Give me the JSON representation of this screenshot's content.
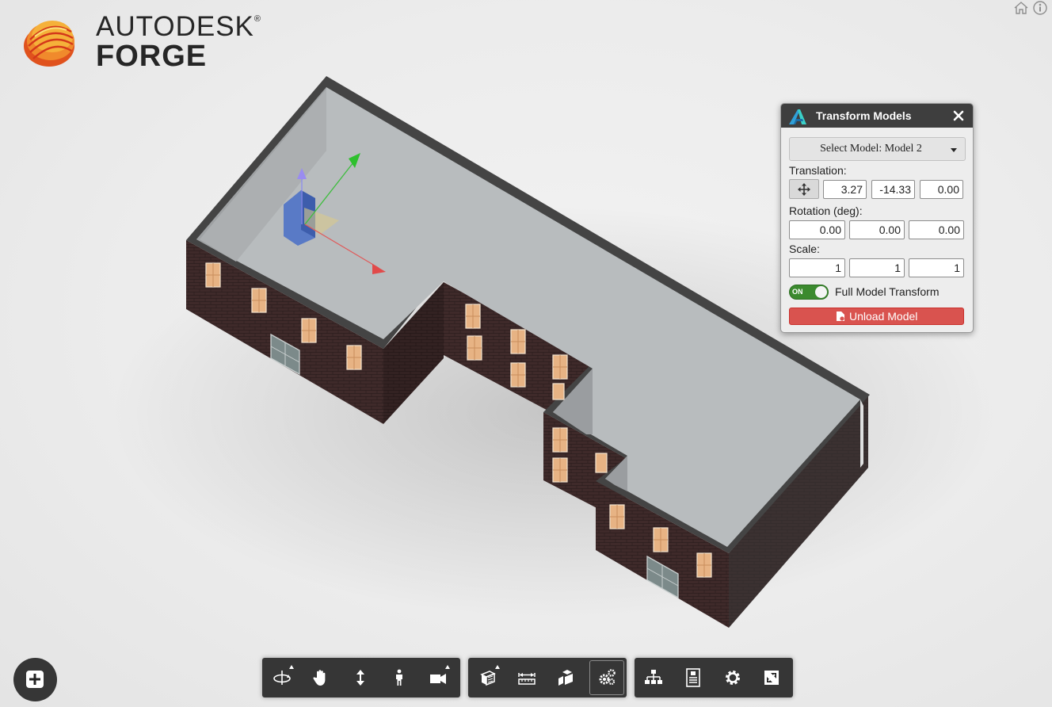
{
  "brand": {
    "line1": "AUTODESK",
    "registered": "®",
    "line2": "FORGE"
  },
  "corner_icons": [
    "home-icon",
    "info-icon"
  ],
  "panel": {
    "title": "Transform Models",
    "model_select": "Select Model: Model 2",
    "translation_label": "Translation:",
    "translation": {
      "x": "3.27",
      "y": "-14.33",
      "z": "0.00"
    },
    "rotation_label": "Rotation (deg):",
    "rotation": {
      "x": "0.00",
      "y": "0.00",
      "z": "0.00"
    },
    "scale_label": "Scale:",
    "scale": {
      "x": "1",
      "y": "1",
      "z": "1"
    },
    "toggle_state": "ON",
    "toggle_label": "Full Model Transform",
    "unload_label": "Unload Model"
  },
  "toolbar": {
    "navigation": [
      "orbit-icon",
      "pan-icon",
      "zoom-icon",
      "first-person-icon",
      "camera-icon"
    ],
    "modeling": [
      "section-icon",
      "measure-icon",
      "explode-icon",
      "transform-gear-icon"
    ],
    "settings": [
      "model-browser-icon",
      "properties-icon",
      "settings-icon",
      "fullscreen-icon"
    ],
    "active": "transform-gear-icon"
  },
  "colors": {
    "panel_header": "#3e3e3e",
    "unload_button": "#d9534f",
    "toggle_on": "#3b8a2e",
    "toolbar": "#222222",
    "roof": "#b9bdbf",
    "parapet": "#454545",
    "brick": "#3f2a2a"
  }
}
